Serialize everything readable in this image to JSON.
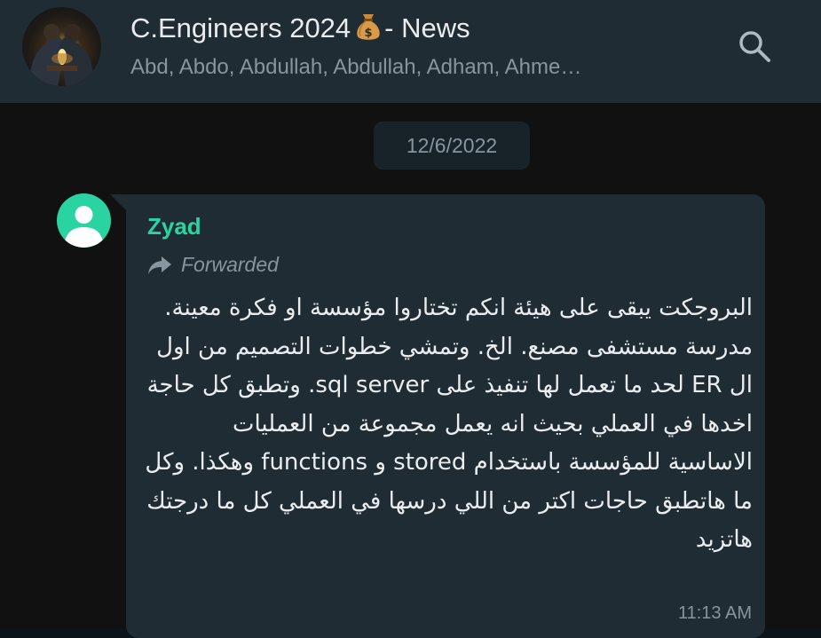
{
  "header": {
    "title_prefix": "C.Engineers 2024",
    "title_emoji_icon": "money-bag-icon",
    "title_suffix": " - News",
    "members": "Abd, Abdo, Abdullah, Abdullah, Adham, Ahme…",
    "search_icon": "search-icon"
  },
  "chat": {
    "date_chip": "12/6/2022",
    "message": {
      "sender": "Zyad",
      "forwarded_label": "Forwarded",
      "text": "البروجكت يبقى على هيئة انكم تختاروا مؤسسة او فكرة معينة. مدرسة مستشفى مصنع. الخ. وتمشي خطوات التصميم من اول ال ER لحد ما تعمل لها تنفيذ على sql server. وتطبق كل حاجة اخدها في العملي بحيث انه يعمل مجموعة من العمليات الاساسية للمؤسسة باستخدام stored و functions وهكذا. وكل ما هاتطبق حاجات اكتر من اللي درسها في العملي كل ما درجتك هاتزيد",
      "time": "11:13 AM"
    }
  },
  "colors": {
    "header_bg": "#202c33",
    "chat_bg": "#111111",
    "bubble_bg": "#202c33",
    "accent_green": "#2ad3a2",
    "primary_text": "#e9edef",
    "secondary_text": "#8696a0"
  }
}
